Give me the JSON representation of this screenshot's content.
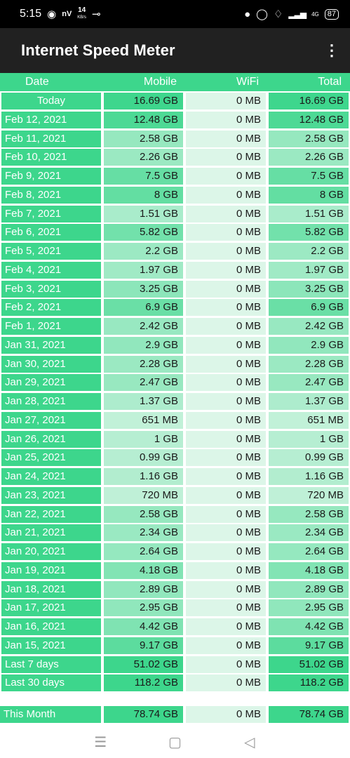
{
  "status_bar": {
    "time": "5:15",
    "net_speed_value": "14",
    "net_speed_unit": "KB/s",
    "network": "4G",
    "battery": "87"
  },
  "app": {
    "title": "Internet Speed Meter"
  },
  "columns": {
    "date": "Date",
    "mobile": "Mobile",
    "wifi": "WiFi",
    "total": "Total"
  },
  "colors": {
    "accent": "#3dd68c",
    "appbar": "#212121"
  },
  "rows": [
    {
      "date": "Today",
      "mobile": "16.69 GB",
      "wifi": "0 MB",
      "total": "16.69 GB",
      "mobile_gb": 16.69
    },
    {
      "date": "Feb 12, 2021",
      "mobile": "12.48 GB",
      "wifi": "0 MB",
      "total": "12.48 GB",
      "mobile_gb": 12.48
    },
    {
      "date": "Feb 11, 2021",
      "mobile": "2.58 GB",
      "wifi": "0 MB",
      "total": "2.58 GB",
      "mobile_gb": 2.58
    },
    {
      "date": "Feb 10, 2021",
      "mobile": "2.26 GB",
      "wifi": "0 MB",
      "total": "2.26 GB",
      "mobile_gb": 2.26
    },
    {
      "date": "Feb 9, 2021",
      "mobile": "7.5 GB",
      "wifi": "0 MB",
      "total": "7.5 GB",
      "mobile_gb": 7.5
    },
    {
      "date": "Feb 8, 2021",
      "mobile": "8 GB",
      "wifi": "0 MB",
      "total": "8 GB",
      "mobile_gb": 8
    },
    {
      "date": "Feb 7, 2021",
      "mobile": "1.51 GB",
      "wifi": "0 MB",
      "total": "1.51 GB",
      "mobile_gb": 1.51
    },
    {
      "date": "Feb 6, 2021",
      "mobile": "5.82 GB",
      "wifi": "0 MB",
      "total": "5.82 GB",
      "mobile_gb": 5.82
    },
    {
      "date": "Feb 5, 2021",
      "mobile": "2.2 GB",
      "wifi": "0 MB",
      "total": "2.2 GB",
      "mobile_gb": 2.2
    },
    {
      "date": "Feb 4, 2021",
      "mobile": "1.97 GB",
      "wifi": "0 MB",
      "total": "1.97 GB",
      "mobile_gb": 1.97
    },
    {
      "date": "Feb 3, 2021",
      "mobile": "3.25 GB",
      "wifi": "0 MB",
      "total": "3.25 GB",
      "mobile_gb": 3.25
    },
    {
      "date": "Feb 2, 2021",
      "mobile": "6.9 GB",
      "wifi": "0 MB",
      "total": "6.9 GB",
      "mobile_gb": 6.9
    },
    {
      "date": "Feb 1, 2021",
      "mobile": "2.42 GB",
      "wifi": "0 MB",
      "total": "2.42 GB",
      "mobile_gb": 2.42
    },
    {
      "date": "Jan 31, 2021",
      "mobile": "2.9 GB",
      "wifi": "0 MB",
      "total": "2.9 GB",
      "mobile_gb": 2.9
    },
    {
      "date": "Jan 30, 2021",
      "mobile": "2.28 GB",
      "wifi": "0 MB",
      "total": "2.28 GB",
      "mobile_gb": 2.28
    },
    {
      "date": "Jan 29, 2021",
      "mobile": "2.47 GB",
      "wifi": "0 MB",
      "total": "2.47 GB",
      "mobile_gb": 2.47
    },
    {
      "date": "Jan 28, 2021",
      "mobile": "1.37 GB",
      "wifi": "0 MB",
      "total": "1.37 GB",
      "mobile_gb": 1.37
    },
    {
      "date": "Jan 27, 2021",
      "mobile": "651 MB",
      "wifi": "0 MB",
      "total": "651 MB",
      "mobile_gb": 0.64
    },
    {
      "date": "Jan 26, 2021",
      "mobile": "1 GB",
      "wifi": "0 MB",
      "total": "1 GB",
      "mobile_gb": 1
    },
    {
      "date": "Jan 25, 2021",
      "mobile": "0.99 GB",
      "wifi": "0 MB",
      "total": "0.99 GB",
      "mobile_gb": 0.99
    },
    {
      "date": "Jan 24, 2021",
      "mobile": "1.16 GB",
      "wifi": "0 MB",
      "total": "1.16 GB",
      "mobile_gb": 1.16
    },
    {
      "date": "Jan 23, 2021",
      "mobile": "720 MB",
      "wifi": "0 MB",
      "total": "720 MB",
      "mobile_gb": 0.7
    },
    {
      "date": "Jan 22, 2021",
      "mobile": "2.58 GB",
      "wifi": "0 MB",
      "total": "2.58 GB",
      "mobile_gb": 2.58
    },
    {
      "date": "Jan 21, 2021",
      "mobile": "2.34 GB",
      "wifi": "0 MB",
      "total": "2.34 GB",
      "mobile_gb": 2.34
    },
    {
      "date": "Jan 20, 2021",
      "mobile": "2.64 GB",
      "wifi": "0 MB",
      "total": "2.64 GB",
      "mobile_gb": 2.64
    },
    {
      "date": "Jan 19, 2021",
      "mobile": "4.18 GB",
      "wifi": "0 MB",
      "total": "4.18 GB",
      "mobile_gb": 4.18
    },
    {
      "date": "Jan 18, 2021",
      "mobile": "2.89 GB",
      "wifi": "0 MB",
      "total": "2.89 GB",
      "mobile_gb": 2.89
    },
    {
      "date": "Jan 17, 2021",
      "mobile": "2.95 GB",
      "wifi": "0 MB",
      "total": "2.95 GB",
      "mobile_gb": 2.95
    },
    {
      "date": "Jan 16, 2021",
      "mobile": "4.42 GB",
      "wifi": "0 MB",
      "total": "4.42 GB",
      "mobile_gb": 4.42
    },
    {
      "date": "Jan 15, 2021",
      "mobile": "9.17 GB",
      "wifi": "0 MB",
      "total": "9.17 GB",
      "mobile_gb": 9.17
    },
    {
      "date": "Last 7 days",
      "mobile": "51.02 GB",
      "wifi": "0 MB",
      "total": "51.02 GB",
      "mobile_gb": 51.02
    },
    {
      "date": "Last 30 days",
      "mobile": "118.2 GB",
      "wifi": "0 MB",
      "total": "118.2 GB",
      "mobile_gb": 118.2
    }
  ],
  "month": {
    "date": "This Month",
    "mobile": "78.74 GB",
    "wifi": "0 MB",
    "total": "78.74 GB",
    "mobile_gb": 78.74
  }
}
